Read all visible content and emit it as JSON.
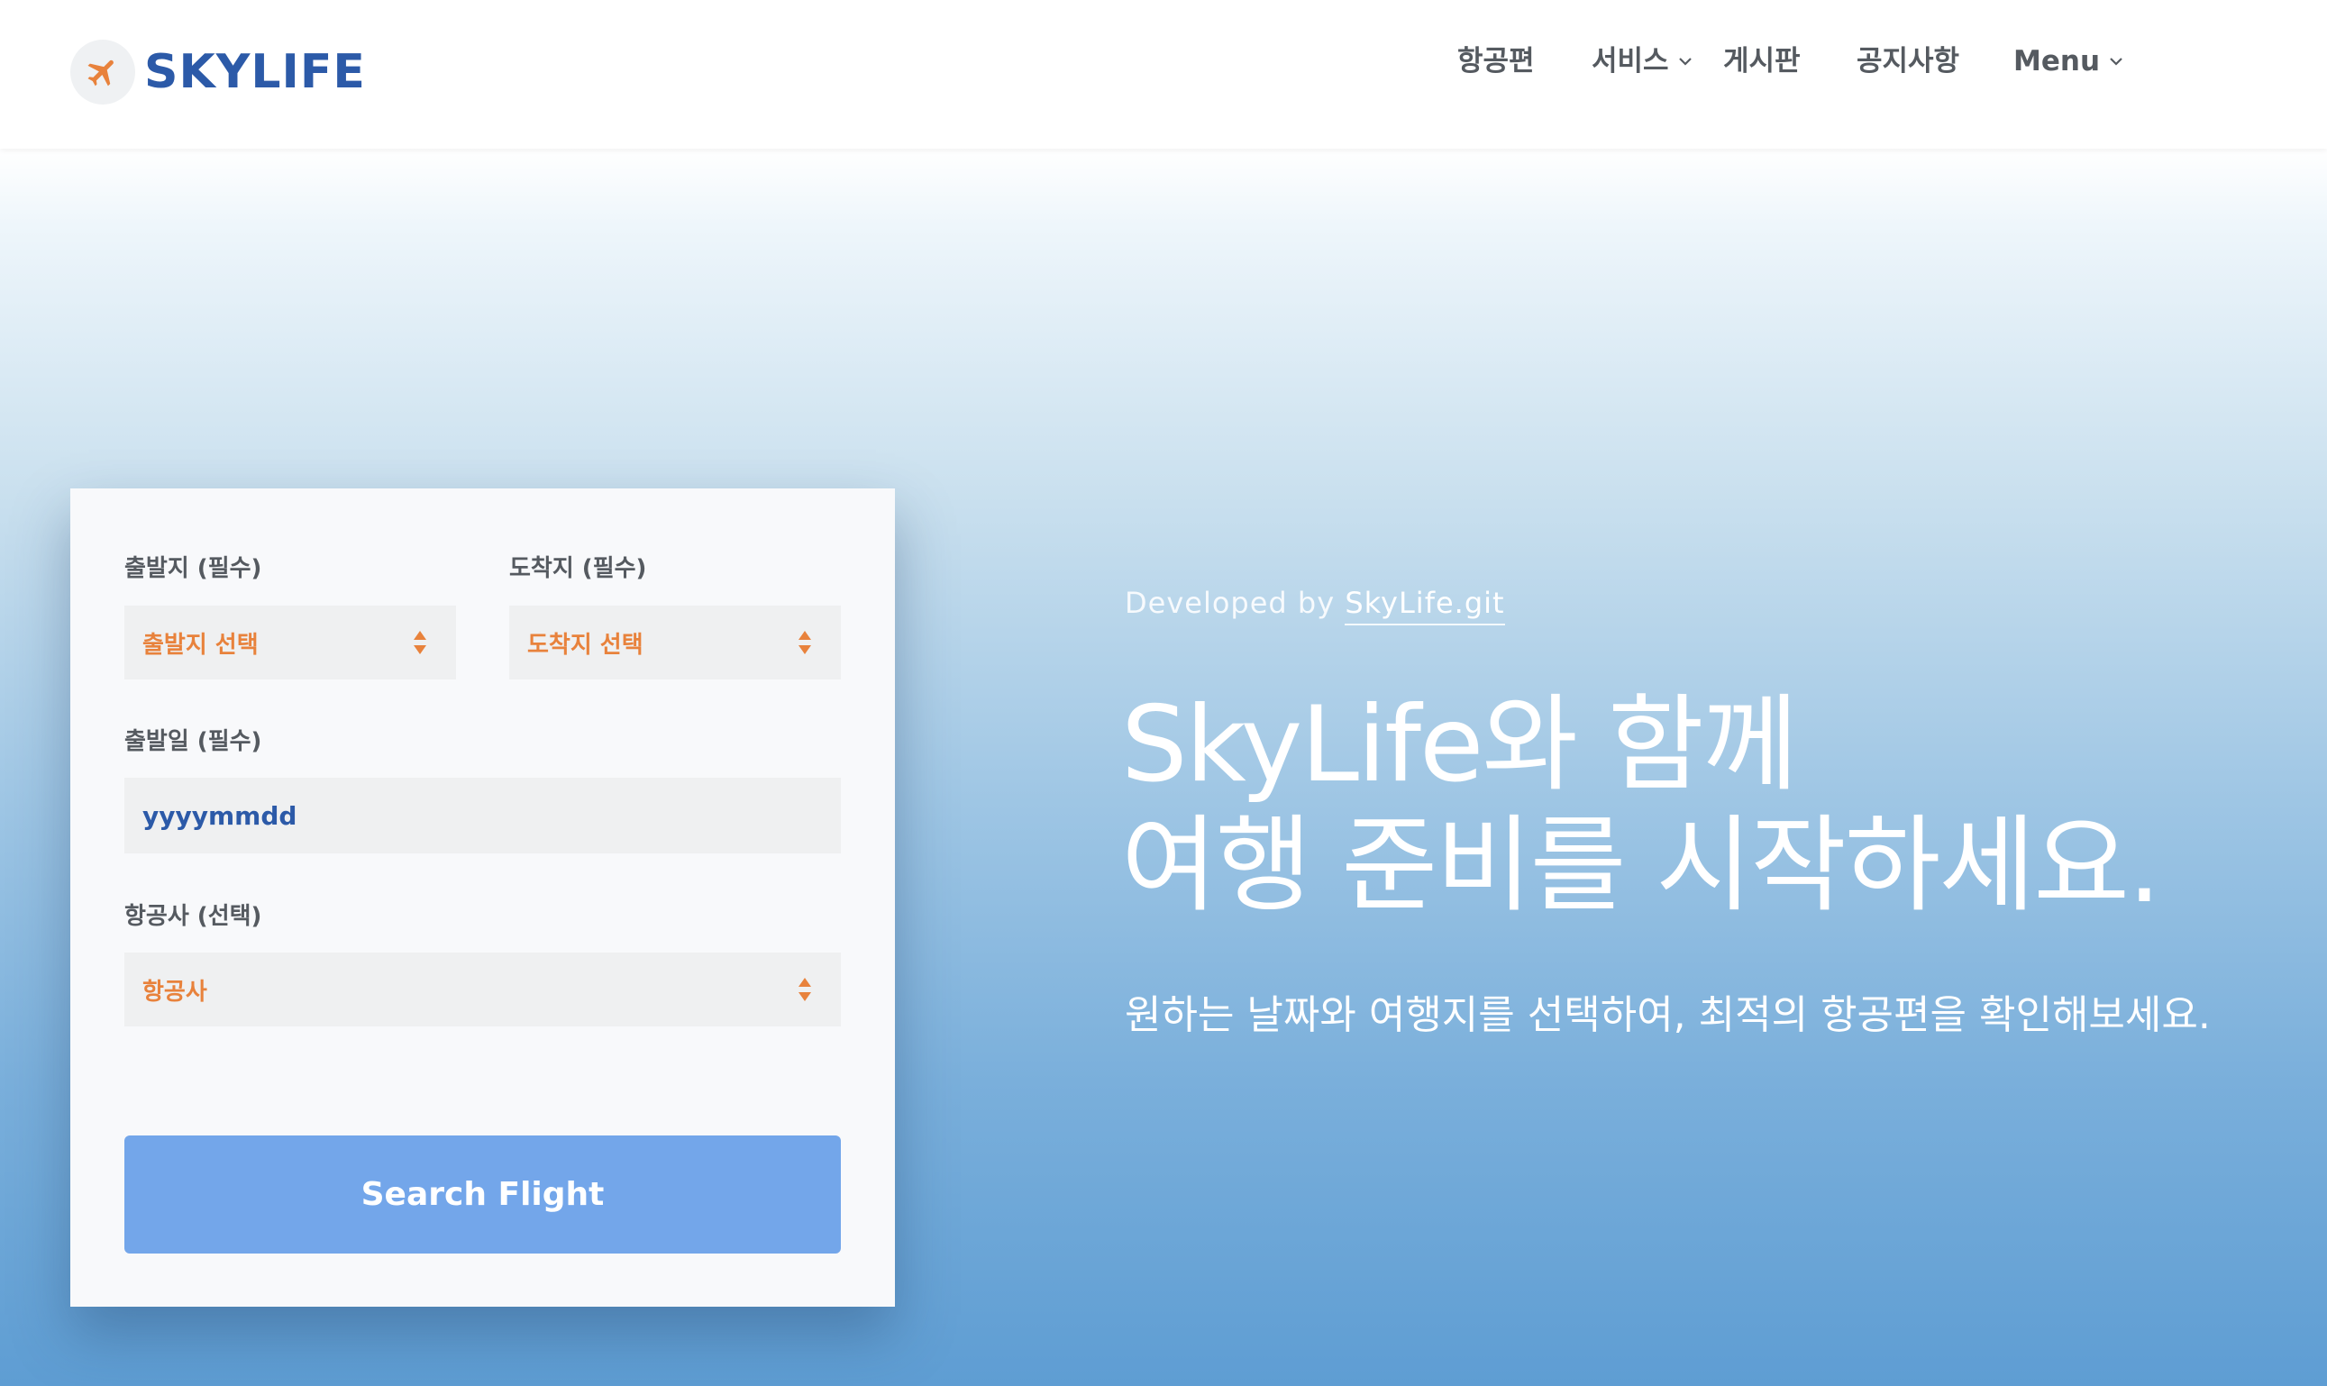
{
  "colors": {
    "brand_blue": "#2c5aa8",
    "accent_orange": "#e8823c",
    "nav_text": "#555a60",
    "label_text": "#555a60",
    "field_bg": "#eff0f1",
    "button_bg": "#73a6ea"
  },
  "header": {
    "logo_text": "SKYLIFE",
    "logo_icon": "airplane-icon",
    "nav": [
      {
        "label": "항공편",
        "has_dropdown": false
      },
      {
        "label": "서비스",
        "has_dropdown": true
      },
      {
        "label": "게시판",
        "has_dropdown": false
      },
      {
        "label": "공지사항",
        "has_dropdown": false
      },
      {
        "label": "Menu",
        "has_dropdown": true
      }
    ]
  },
  "form": {
    "departure": {
      "label": "출발지 (필수)",
      "value": "출발지 선택"
    },
    "arrival": {
      "label": "도착지 (필수)",
      "value": "도착지 선택"
    },
    "date": {
      "label": "출발일 (필수)",
      "placeholder": "yyyymmdd"
    },
    "airline": {
      "label": "항공사 (선택)",
      "value": "항공사"
    },
    "submit_label": "Search Flight"
  },
  "hero": {
    "developed_prefix": "Developed by",
    "developed_link": "SkyLife.git",
    "title_line1": "SkyLife와 함께",
    "title_line2": "여행 준비를 시작하세요.",
    "subtitle": "원하는 날짜와 여행지를 선택하여, 최적의 항공편을 확인해보세요."
  }
}
